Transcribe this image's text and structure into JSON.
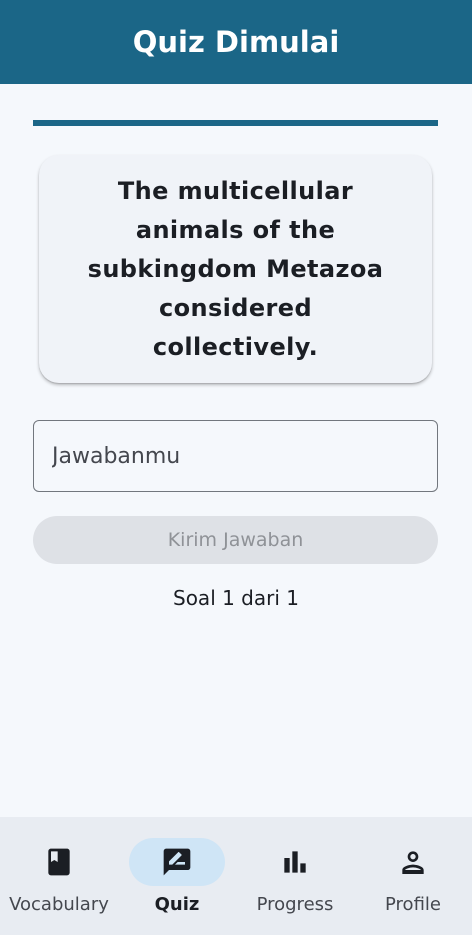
{
  "app_bar": {
    "title": "Quiz Dimulai"
  },
  "progress": {
    "fraction": 1.0
  },
  "question": {
    "text": "The multicellular animals of the subkingdom Metazoa considered collectively."
  },
  "answer_field": {
    "value": "",
    "placeholder": "Jawabanmu"
  },
  "submit_button": {
    "label": "Kirim Jawaban",
    "enabled": false
  },
  "counter": {
    "text": "Soal 1 dari 1"
  },
  "bottom_nav": {
    "items": [
      {
        "label": "Vocabulary",
        "icon": "book-bookmark-icon",
        "active": false
      },
      {
        "label": "Quiz",
        "icon": "rate-review-pen-icon",
        "active": true
      },
      {
        "label": "Progress",
        "icon": "bar-chart-icon",
        "active": false
      },
      {
        "label": "Profile",
        "icon": "person-icon",
        "active": false
      }
    ]
  },
  "colors": {
    "primary": "#1b6687",
    "background": "#f5f8fc",
    "card": "#f0f3f8",
    "nav_background": "#e8ecf2",
    "nav_active_indicator": "#cfe5f6",
    "disabled_button": "#dee1e6"
  }
}
